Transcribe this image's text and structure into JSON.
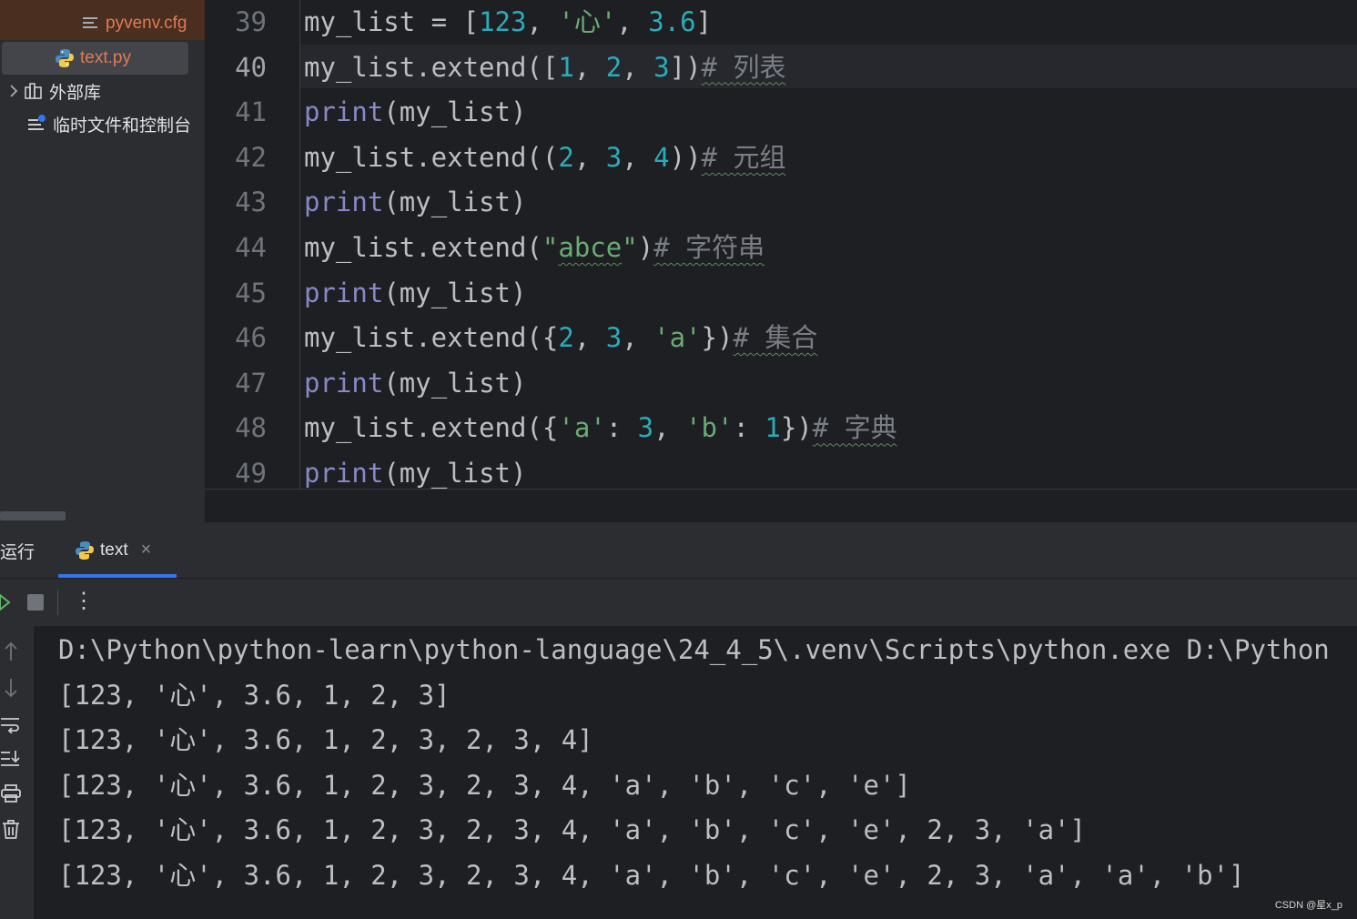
{
  "sidebar": {
    "items": [
      {
        "label": "pyvenv.cfg",
        "icon": "text-file-icon",
        "color": "#e07b53"
      },
      {
        "label": "text.py",
        "icon": "python-file-icon",
        "color": "#e07b53"
      },
      {
        "label": "外部库",
        "icon": "library-icon",
        "color": "#dfe1e5"
      },
      {
        "label": "临时文件和控制台",
        "icon": "scratch-console-icon",
        "color": "#dfe1e5"
      }
    ]
  },
  "editor": {
    "current_line": 40,
    "lines": [
      {
        "n": "39",
        "tokens": [
          [
            "my_list = [",
            "p"
          ],
          [
            "123",
            "num"
          ],
          [
            ", ",
            "p"
          ],
          [
            "'心'",
            "str"
          ],
          [
            ", ",
            "p"
          ],
          [
            "3.6",
            "num"
          ],
          [
            "]",
            "p"
          ]
        ]
      },
      {
        "n": "40",
        "tokens": [
          [
            "my_list.extend([",
            "p"
          ],
          [
            "1",
            "num"
          ],
          [
            ", ",
            "p"
          ],
          [
            "2",
            "num"
          ],
          [
            ", ",
            "p"
          ],
          [
            "3",
            "num"
          ],
          [
            "])",
            "p"
          ],
          [
            "# 列表",
            "cmt"
          ]
        ]
      },
      {
        "n": "41",
        "tokens": [
          [
            "print",
            "bi"
          ],
          [
            "(my_list)",
            "p"
          ]
        ]
      },
      {
        "n": "42",
        "tokens": [
          [
            "my_list.extend((",
            "p"
          ],
          [
            "2",
            "num"
          ],
          [
            ", ",
            "p"
          ],
          [
            "3",
            "num"
          ],
          [
            ", ",
            "p"
          ],
          [
            "4",
            "num"
          ],
          [
            "))",
            "p"
          ],
          [
            "# 元组",
            "cmt"
          ]
        ]
      },
      {
        "n": "43",
        "tokens": [
          [
            "print",
            "bi"
          ],
          [
            "(my_list)",
            "p"
          ]
        ]
      },
      {
        "n": "44",
        "tokens": [
          [
            "my_list.extend(",
            "p"
          ],
          [
            "\"",
            "str"
          ],
          [
            "abce",
            "str typo"
          ],
          [
            "\"",
            "str"
          ],
          [
            ")",
            "p"
          ],
          [
            "# 字符串",
            "cmt"
          ]
        ]
      },
      {
        "n": "45",
        "tokens": [
          [
            "print",
            "bi"
          ],
          [
            "(my_list)",
            "p"
          ]
        ]
      },
      {
        "n": "46",
        "tokens": [
          [
            "my_list.extend({",
            "p"
          ],
          [
            "2",
            "num"
          ],
          [
            ", ",
            "p"
          ],
          [
            "3",
            "num"
          ],
          [
            ", ",
            "p"
          ],
          [
            "'a'",
            "str"
          ],
          [
            "})",
            "p"
          ],
          [
            "# 集合",
            "cmt"
          ]
        ]
      },
      {
        "n": "47",
        "tokens": [
          [
            "print",
            "bi"
          ],
          [
            "(my_list)",
            "p"
          ]
        ]
      },
      {
        "n": "48",
        "tokens": [
          [
            "my_list.extend({",
            "p"
          ],
          [
            "'a'",
            "str"
          ],
          [
            ": ",
            "p"
          ],
          [
            "3",
            "num"
          ],
          [
            ", ",
            "p"
          ],
          [
            "'b'",
            "str"
          ],
          [
            ": ",
            "p"
          ],
          [
            "1",
            "num"
          ],
          [
            "})",
            "p"
          ],
          [
            "# 字典",
            "cmt"
          ]
        ]
      },
      {
        "n": "49",
        "tokens": [
          [
            "print",
            "bi"
          ],
          [
            "(my_list)",
            "p"
          ]
        ]
      }
    ]
  },
  "run_panel": {
    "title": "运行",
    "tab_label": "text",
    "tab_icon": "python-file-icon",
    "close_glyph": "×",
    "menu_glyph": "⋮",
    "output": [
      "D:\\Python\\python-learn\\python-language\\24_4_5\\.venv\\Scripts\\python.exe D:\\Python",
      "[123, '心', 3.6, 1, 2, 3]",
      "[123, '心', 3.6, 1, 2, 3, 2, 3, 4]",
      "[123, '心', 3.6, 1, 2, 3, 2, 3, 4, 'a', 'b', 'c', 'e']",
      "[123, '心', 3.6, 1, 2, 3, 2, 3, 4, 'a', 'b', 'c', 'e', 2, 3, 'a']",
      "[123, '心', 3.6, 1, 2, 3, 2, 3, 4, 'a', 'b', 'c', 'e', 2, 3, 'a', 'a', 'b']"
    ]
  },
  "watermark": "CSDN @星x_p",
  "colors": {
    "background": "#1e1f22",
    "panel": "#2b2d30",
    "accent": "#3574f0",
    "number": "#2aacb8",
    "string": "#6aab73",
    "builtin": "#8888c6",
    "comment": "#7a7e85"
  }
}
